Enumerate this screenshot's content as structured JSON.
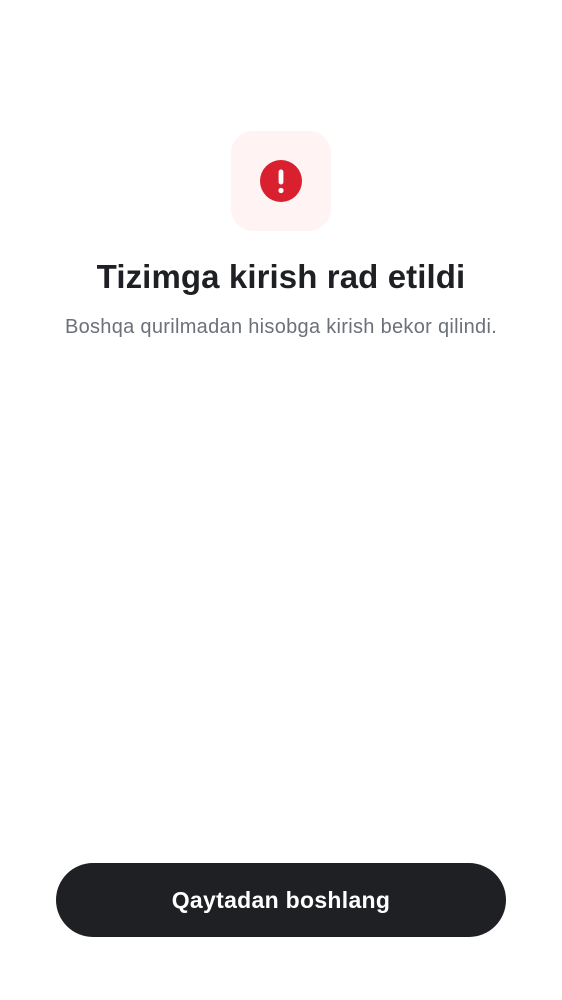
{
  "status": {
    "icon": "exclamation-circle-icon",
    "icon_color": "#d9202f",
    "tile_color": "#fff4f3",
    "title": "Tizimga kirish rad etildi",
    "message": "Boshqa qurilmadan hisobga kirish bekor qilindi."
  },
  "actions": {
    "restart_label": "Qaytadan boshlang",
    "button_color": "#1f2024"
  }
}
